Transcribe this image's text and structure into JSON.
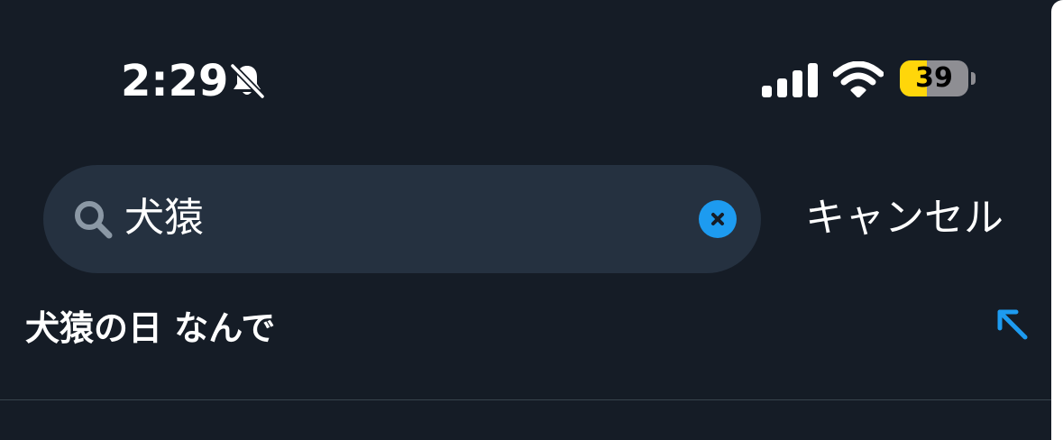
{
  "status_bar": {
    "time": "2:29",
    "battery_level": "39",
    "battery_fraction": 0.39,
    "icons": [
      "bell-slash-icon",
      "cellular-signal-icon",
      "wifi-icon",
      "battery-icon"
    ]
  },
  "search": {
    "value": "犬猿",
    "cancel_label": "キャンセル",
    "accent_color": "#1d9bf0"
  },
  "suggestions": [
    {
      "text": "犬猿の日 なんで"
    }
  ]
}
